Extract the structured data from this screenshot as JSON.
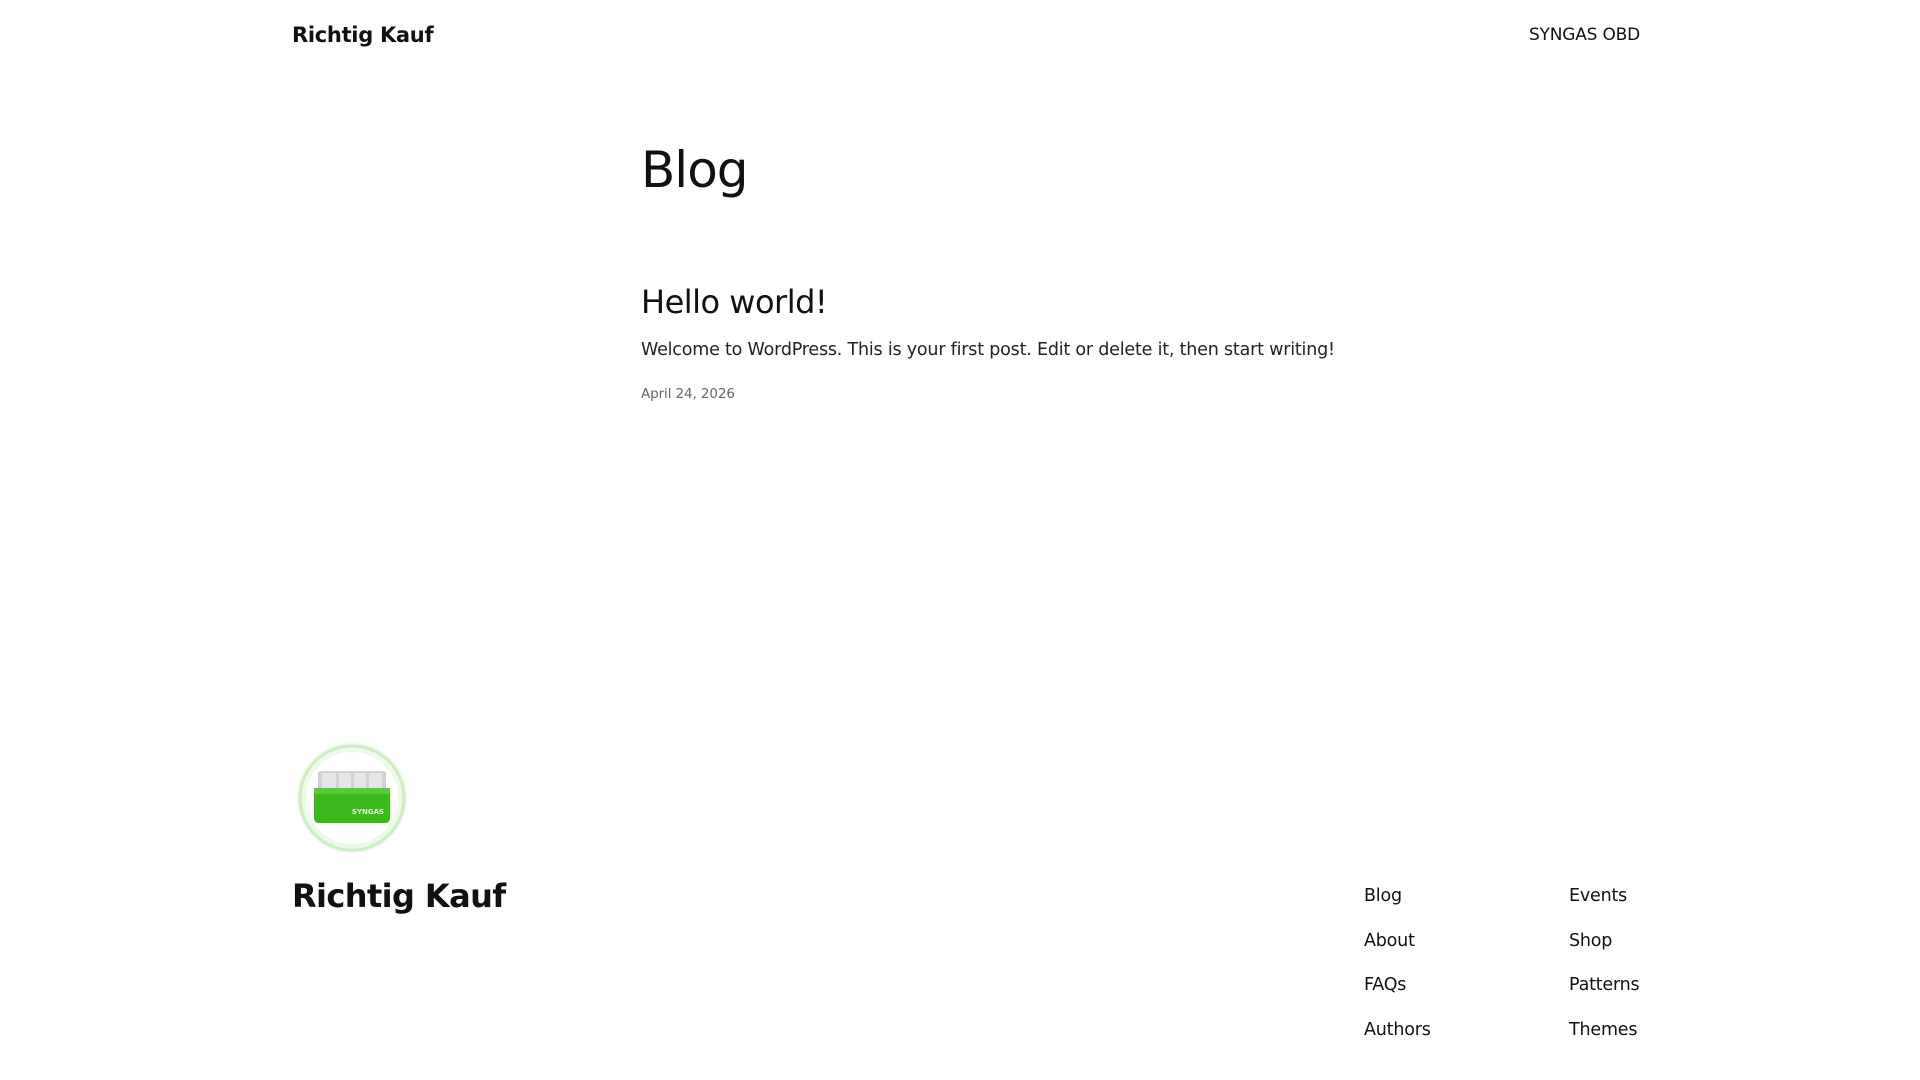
{
  "header": {
    "site_title": "Richtig Kauf",
    "nav_item": "SYNGAS OBD"
  },
  "main": {
    "heading": "Blog",
    "posts": [
      {
        "title": "Hello world!",
        "excerpt": "Welcome to WordPress. This is your first post. Edit or delete it, then start writing!",
        "date": "April 24, 2026"
      }
    ]
  },
  "footer": {
    "logo_text": "SYNGAS",
    "site_title": "Richtig Kauf",
    "nav_col_1": [
      "Blog",
      "About",
      "FAQs",
      "Authors"
    ],
    "nav_col_2": [
      "Events",
      "Shop",
      "Patterns",
      "Themes"
    ]
  },
  "colors": {
    "text": "#111111",
    "muted": "#666666",
    "logo_green": "#3cba1c",
    "logo_ring": "#e8f7e4"
  }
}
